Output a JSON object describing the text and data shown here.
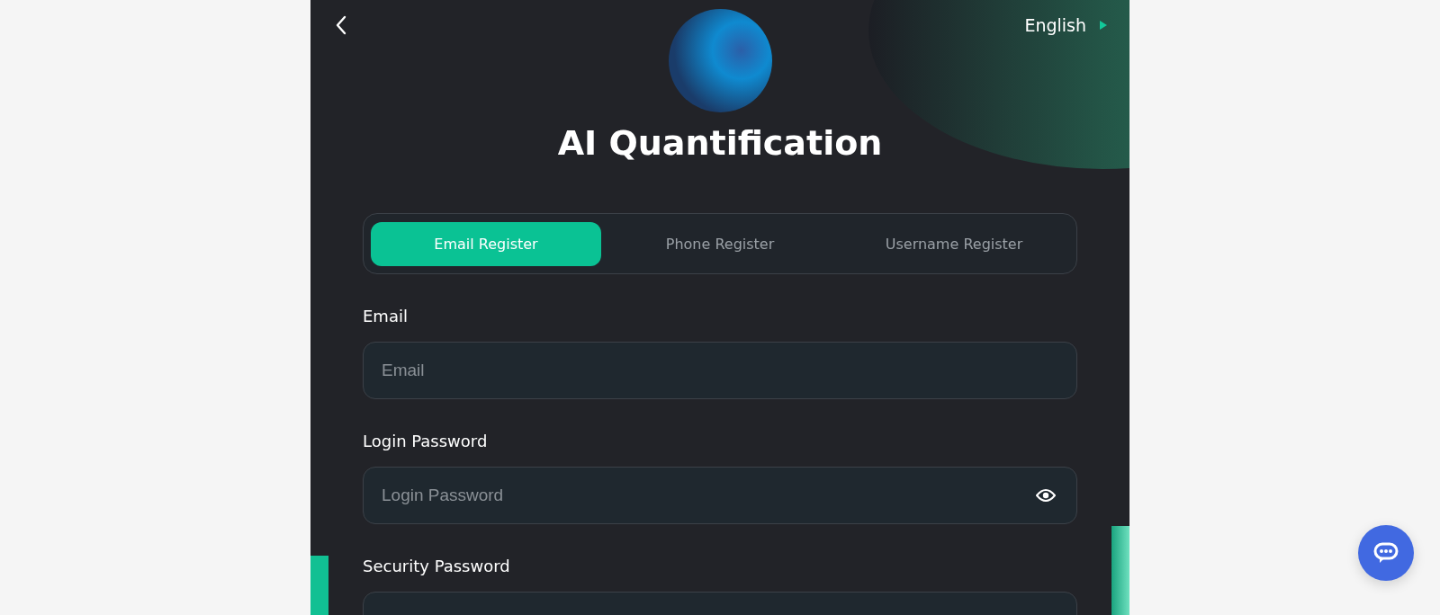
{
  "header": {
    "language": "English",
    "title": "AI Quantification"
  },
  "tabs": [
    {
      "label": "Email Register",
      "selected": true
    },
    {
      "label": "Phone Register",
      "selected": false
    },
    {
      "label": "Username Register",
      "selected": false
    }
  ],
  "fields": [
    {
      "label": "Email",
      "placeholder": "Email",
      "kind": "text"
    },
    {
      "label": "Login Password",
      "placeholder": "Login Password",
      "kind": "password"
    },
    {
      "label": "Security Password",
      "kind": "password"
    }
  ]
}
